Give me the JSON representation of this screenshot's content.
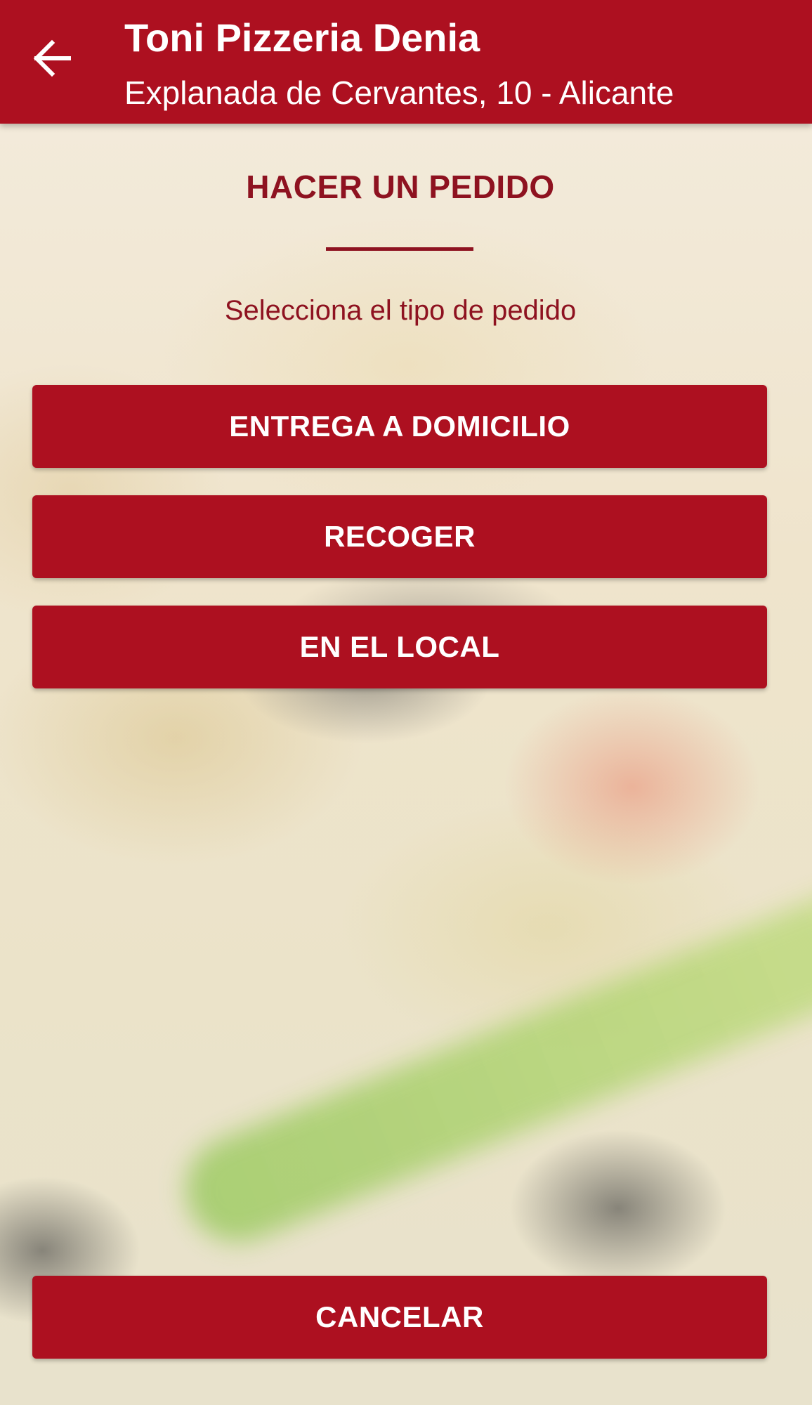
{
  "header": {
    "title": "Toni Pizzeria Denia",
    "subtitle": "Explanada de Cervantes, 10 - Alicante",
    "back_icon": "arrow-back-icon"
  },
  "order": {
    "heading": "HACER UN PEDIDO",
    "instruction": "Selecciona el tipo de pedido",
    "options": [
      {
        "label": "ENTREGA A DOMICILIO"
      },
      {
        "label": "RECOGER"
      },
      {
        "label": "EN EL LOCAL"
      }
    ],
    "cancel_label": "CANCELAR"
  },
  "colors": {
    "primary": "#ad1020",
    "text_accent": "#8e1220",
    "on_primary": "#ffffff"
  }
}
